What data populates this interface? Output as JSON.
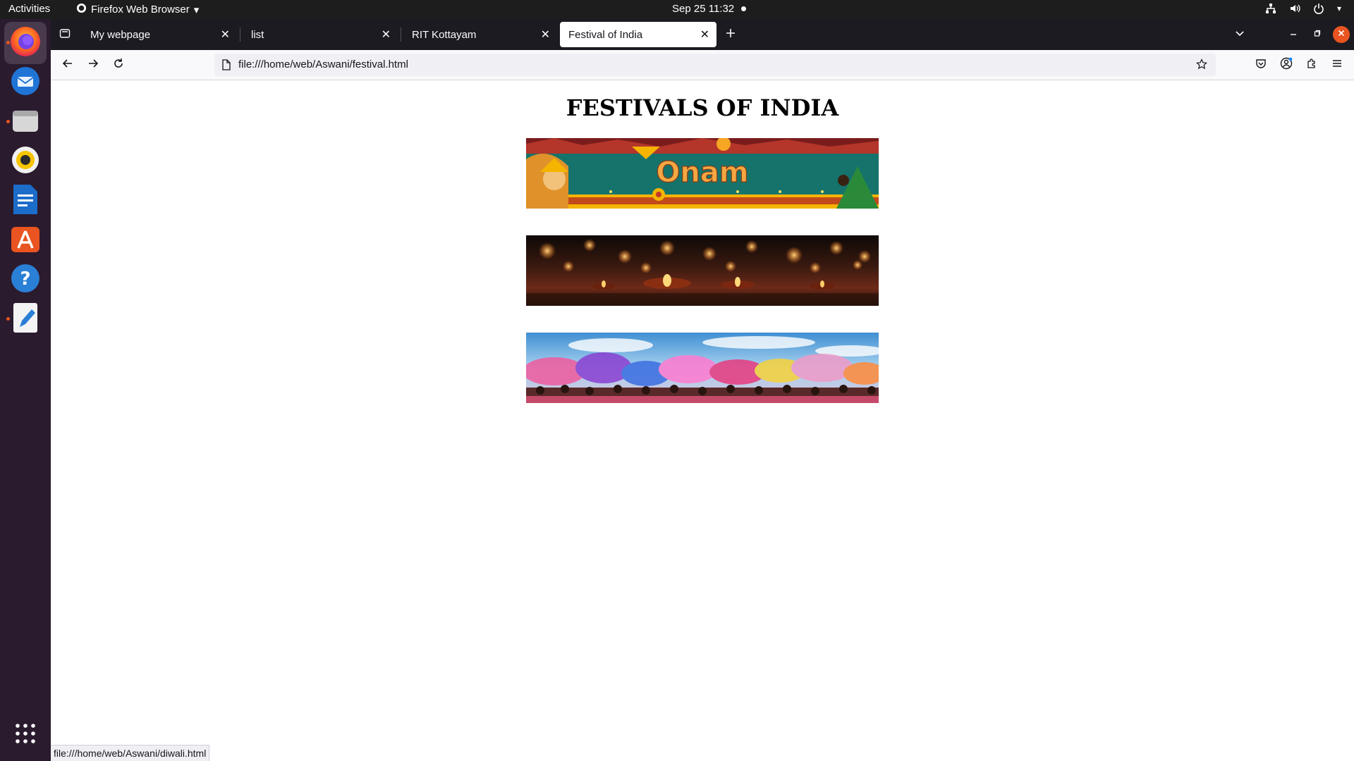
{
  "system": {
    "activities": "Activities",
    "app_menu": "Firefox Web Browser",
    "clock": "Sep 25  11:32"
  },
  "dock": {
    "items": [
      "firefox-icon",
      "thunderbird-icon",
      "files-icon",
      "rhythmbox-icon",
      "writer-icon",
      "app-center-icon",
      "help-icon",
      "text-editor-icon",
      "show-apps-icon"
    ]
  },
  "browser": {
    "tabs": [
      {
        "label": "My webpage",
        "active": false
      },
      {
        "label": "list",
        "active": false
      },
      {
        "label": "RIT Kottayam",
        "active": false
      },
      {
        "label": "Festival of India",
        "active": true
      }
    ],
    "url": "file:///home/web/Aswani/festival.html",
    "status_url": "file:///home/web/Aswani/diwali.html"
  },
  "page": {
    "heading": "FESTIVALS OF INDIA",
    "banners": [
      {
        "name": "onam",
        "text": "Onam"
      },
      {
        "name": "diwali",
        "text": ""
      },
      {
        "name": "holi",
        "text": ""
      }
    ]
  },
  "colors": {
    "topbar": "#1d1d1d",
    "dock": "#2b1b2e",
    "accent": "#e95420",
    "tabbar": "#1c1b22"
  }
}
